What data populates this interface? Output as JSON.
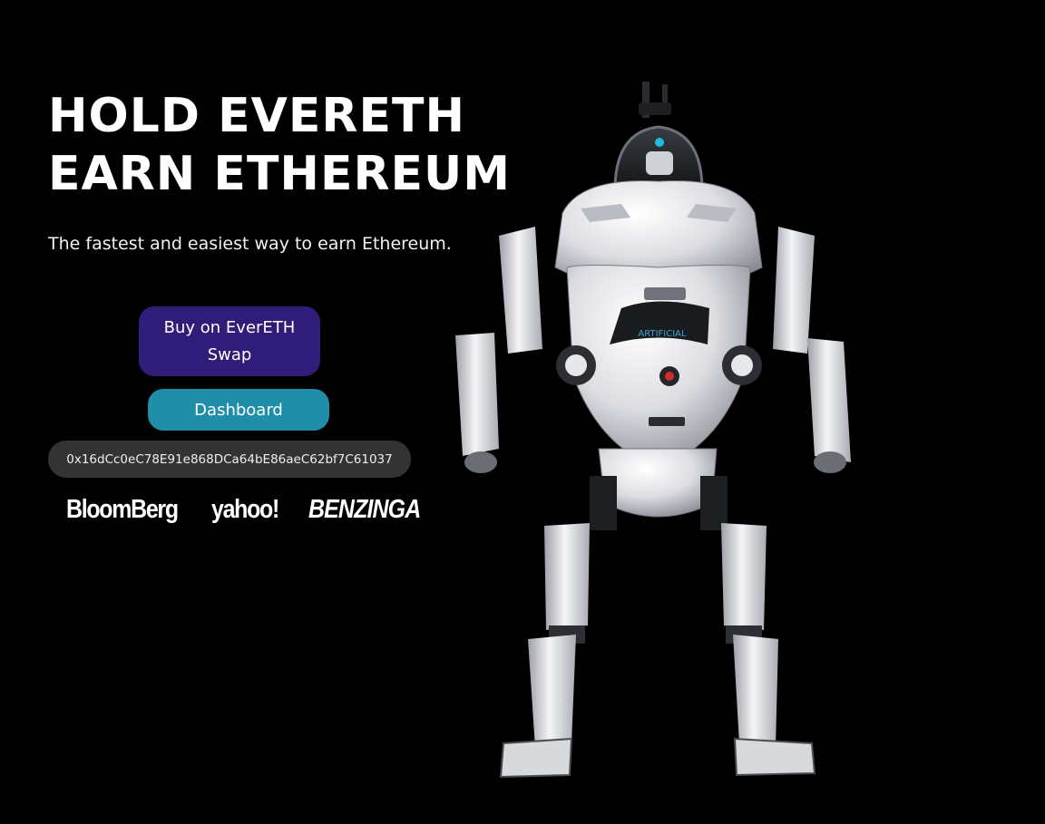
{
  "hero": {
    "title_line1": "HOLD EVERETH",
    "title_line2": "EARN ETHEREUM",
    "subtitle": "The fastest and easiest way to earn Ethereum."
  },
  "actions": {
    "buy_label": "Buy on EverETH Swap",
    "dashboard_label": "Dashboard"
  },
  "contract": {
    "address": "0x16dCc0eC78E91e868DCa64bE86aeC62bf7C61037"
  },
  "press": {
    "items": [
      "BloomBerg",
      "yahoo!",
      "BENZINGA"
    ]
  },
  "robot": {
    "chest_label": "ARTIFICIAL"
  },
  "colors": {
    "background": "#000000",
    "buy_button": "#2f1d79",
    "dashboard_button": "#1f8fa9",
    "contract_pill": "#333333",
    "text": "#ffffff"
  }
}
